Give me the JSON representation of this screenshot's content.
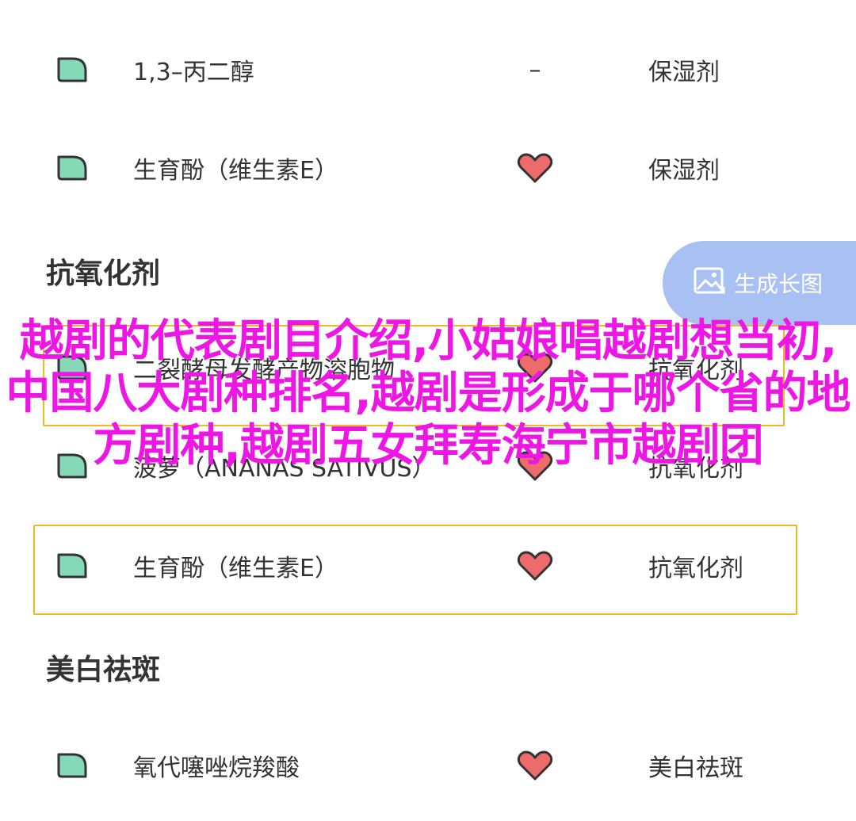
{
  "colors": {
    "leaf_fill": "#86d9b6",
    "leaf_stroke": "#333333",
    "heart_fill": "#ee6b6b",
    "heart_stroke": "#333333",
    "highlight_border": "#f2b824",
    "button_bg": "#a8c1f2",
    "overlay_text": "#ee16e4"
  },
  "rows_top": [
    {
      "name": "1,3–丙二醇",
      "rating": "–",
      "function": "保湿剂"
    },
    {
      "name": "生育酚（维生素E）",
      "rating": "heart",
      "function": "保湿剂"
    }
  ],
  "sections": [
    {
      "title": "抗氧化剂"
    },
    {
      "title": "美白祛斑"
    }
  ],
  "rows_antioxidant": [
    {
      "name": "二裂酵母发酵产物溶胞物",
      "rating": "heart",
      "function": "抗氧化剂"
    },
    {
      "name": "菠萝（ANANAS SATIVUS）",
      "rating": "heart",
      "function": "抗氧化剂"
    },
    {
      "name": "生育酚（维生素E）",
      "rating": "heart",
      "function": "抗氧化剂"
    }
  ],
  "rows_whitening": [
    {
      "name": "氧代噻唑烷羧酸",
      "rating": "heart",
      "function": "美白祛斑"
    }
  ],
  "generate_button": {
    "label": "生成长图",
    "icon": "image-icon"
  },
  "overlay": {
    "text": "越剧的代表剧目介绍,小姑娘唱越剧想当初,中国八大剧种排名,越剧是形成于哪个省的地方剧种,越剧五女拜寿海宁市越剧团"
  }
}
